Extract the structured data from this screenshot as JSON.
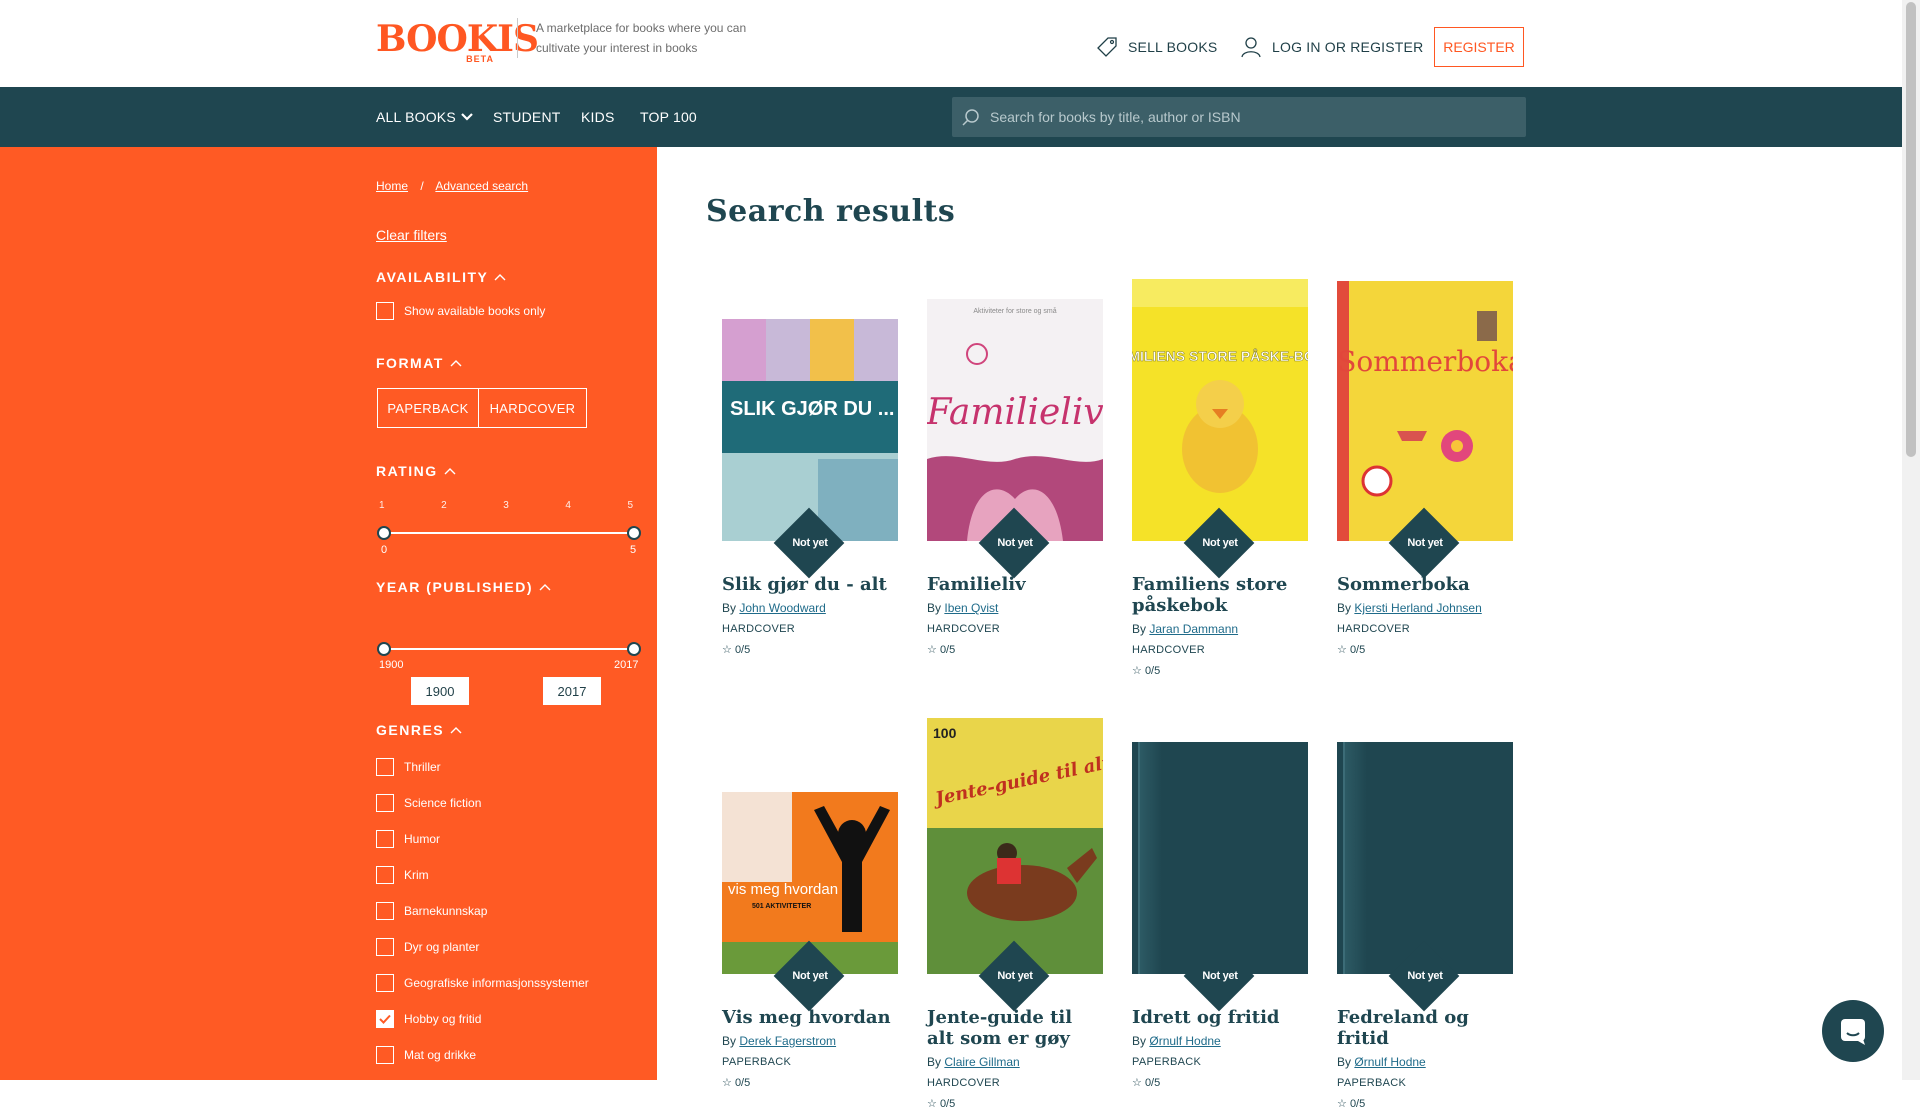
{
  "header": {
    "logo_text": "BOOKIS",
    "logo_beta": "BETA",
    "tagline": "A marketplace for books where you can cultivate your interest in books",
    "sell_label": "SELL BOOKS",
    "login_label": "LOG IN OR REGISTER",
    "register_label": "REGISTER"
  },
  "nav": {
    "items": [
      "ALL BOOKS",
      "STUDENT",
      "KIDS",
      "TOP 100"
    ],
    "search_placeholder": "Search for books by title, author or ISBN"
  },
  "filters": {
    "breadcrumb": [
      "Home",
      "Advanced search"
    ],
    "breadcrumb_sep": "/",
    "clear_label": "Clear filters",
    "availability": {
      "title": "AVAILABILITY",
      "option": "Show available books only",
      "checked": false
    },
    "format": {
      "title": "FORMAT",
      "options": [
        "PAPERBACK",
        "HARDCOVER"
      ]
    },
    "rating": {
      "title": "RATING",
      "ticks": [
        "1",
        "2",
        "3",
        "4",
        "5"
      ],
      "min": "0",
      "max": "5"
    },
    "year": {
      "title": "YEAR (PUBLISHED)",
      "min_label": "1900",
      "max_label": "2017",
      "from": "1900",
      "to": "2017"
    },
    "genres": {
      "title": "GENRES",
      "items": [
        {
          "label": "Thriller",
          "checked": false
        },
        {
          "label": "Science fiction",
          "checked": false
        },
        {
          "label": "Humor",
          "checked": false
        },
        {
          "label": "Krim",
          "checked": false
        },
        {
          "label": "Barnekunnskap",
          "checked": false
        },
        {
          "label": "Dyr og planter",
          "checked": false
        },
        {
          "label": "Geografiske informasjonssystemer",
          "checked": false
        },
        {
          "label": "Hobby og fritid",
          "checked": true
        },
        {
          "label": "Mat og drikke",
          "checked": false
        }
      ]
    }
  },
  "main": {
    "title": "Search results",
    "badge": "Not yet",
    "by_prefix": "By",
    "books": [
      {
        "title": "Slik gjør du - alt",
        "author": "John Woodward",
        "format": "HARDCOVER",
        "rating": "0/5",
        "cover_text": "SLIK GJØR DU ... ALT"
      },
      {
        "title": "Familieliv",
        "author": "Iben Qvist",
        "format": "HARDCOVER",
        "rating": "0/5",
        "cover_text": "Familieliv",
        "cover_sub": "Aktiviteter for store og små"
      },
      {
        "title": "Familiens store påskebok",
        "author": "Jaran Dammann",
        "format": "HARDCOVER",
        "rating": "0/5",
        "cover_text": "FAMILIENS STORE PÅSKE-BOK!"
      },
      {
        "title": "Sommerboka",
        "author": "Kjersti Herland Johnsen",
        "format": "HARDCOVER",
        "rating": "0/5",
        "cover_text": "Sommerboka"
      },
      {
        "title": "Vis meg hvordan",
        "author": "Derek Fagerstrom",
        "format": "PAPERBACK",
        "rating": "0/5",
        "cover_text": "vis meg hvordan",
        "cover_sub": "501 AKTIVITETER"
      },
      {
        "title": "Jente-guide til alt som er gøy",
        "author": "Claire Gillman",
        "format": "HARDCOVER",
        "rating": "0/5",
        "cover_text": "Jente-guide til alt som er gøy",
        "cover_sub": "100"
      },
      {
        "title": "Idrett og fritid",
        "author": "Ørnulf Hodne",
        "format": "PAPERBACK",
        "rating": "0/5"
      },
      {
        "title": "Fedreland og fritid",
        "author": "Ørnulf Hodne",
        "format": "PAPERBACK",
        "rating": "0/5"
      }
    ]
  },
  "colors": {
    "orange": "#ff5a24",
    "teal": "#1f4650",
    "nav": "#1f4650"
  }
}
